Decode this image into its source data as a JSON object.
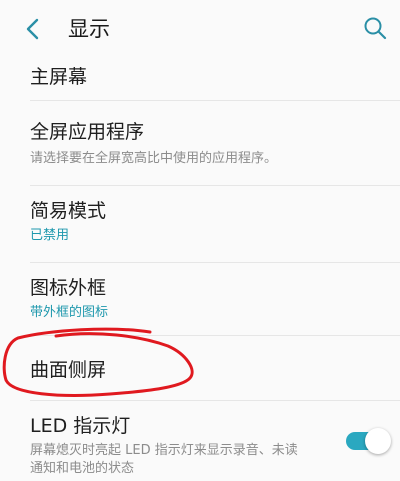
{
  "header": {
    "title": "显示"
  },
  "items": [
    {
      "title": "主屏幕"
    },
    {
      "title": "全屏应用程序",
      "subtitle": "请选择要在全屏宽高比中使用的应用程序。"
    },
    {
      "title": "简易模式",
      "subtitle": "已禁用"
    },
    {
      "title": "图标外框",
      "subtitle": "带外框的图标"
    },
    {
      "title": "曲面侧屏"
    },
    {
      "title": "LED 指示灯",
      "subtitle_line1": "屏幕熄灭时亮起 LED 指示灯来显示录音、未读",
      "subtitle_line2": "通知和电池的状态",
      "toggle_on": true
    }
  ],
  "colors": {
    "accent": "#1e98ad",
    "toggle_track": "#2aa8c0",
    "annotation": "#e0191f",
    "icon": "#2a8fa6"
  },
  "icons": {
    "back": "chevron-left-icon",
    "search": "search-icon"
  }
}
